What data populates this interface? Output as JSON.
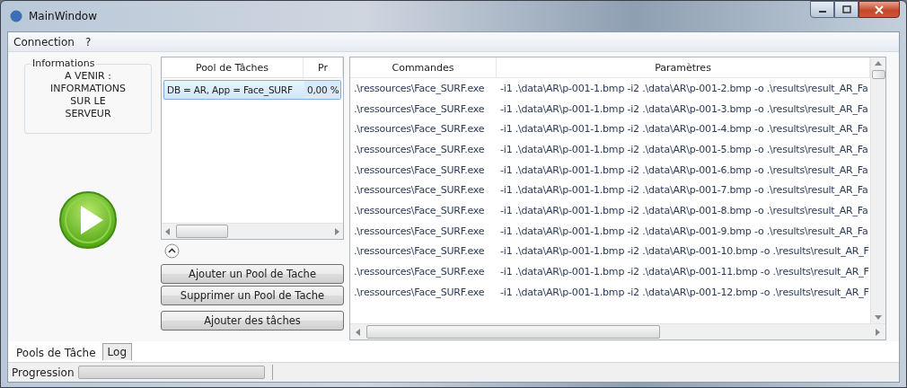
{
  "window": {
    "title": "MainWindow"
  },
  "menu": [
    {
      "label": "Connection"
    },
    {
      "label": "?"
    }
  ],
  "info_group": {
    "title": "Informations",
    "text": "A VENIR :\nINFORMATIONS\nSUR LE\nSERVEUR"
  },
  "pool_list": {
    "columns": [
      "Pool de Tâches",
      "Pr"
    ],
    "rows": [
      {
        "cells": [
          "DB = AR, App = Face_SURF",
          "0,00 %"
        ],
        "selected": true
      }
    ]
  },
  "pool_buttons": [
    "Ajouter un Pool de Tache",
    "Supprimer un Pool de Tache",
    "Ajouter des tâches"
  ],
  "commands_table": {
    "columns": [
      "Commandes",
      "Paramètres"
    ],
    "rows": [
      [
        ".\\ressources\\Face_SURF.exe",
        "-i1 .\\data\\AR\\p-001-1.bmp -i2 .\\data\\AR\\p-001-2.bmp -o .\\results\\result_AR_Fa"
      ],
      [
        ".\\ressources\\Face_SURF.exe",
        "-i1 .\\data\\AR\\p-001-1.bmp -i2 .\\data\\AR\\p-001-3.bmp -o .\\results\\result_AR_Fa"
      ],
      [
        ".\\ressources\\Face_SURF.exe",
        "-i1 .\\data\\AR\\p-001-1.bmp -i2 .\\data\\AR\\p-001-4.bmp -o .\\results\\result_AR_Fa"
      ],
      [
        ".\\ressources\\Face_SURF.exe",
        "-i1 .\\data\\AR\\p-001-1.bmp -i2 .\\data\\AR\\p-001-5.bmp -o .\\results\\result_AR_Fa"
      ],
      [
        ".\\ressources\\Face_SURF.exe",
        "-i1 .\\data\\AR\\p-001-1.bmp -i2 .\\data\\AR\\p-001-6.bmp -o .\\results\\result_AR_Fa"
      ],
      [
        ".\\ressources\\Face_SURF.exe",
        "-i1 .\\data\\AR\\p-001-1.bmp -i2 .\\data\\AR\\p-001-7.bmp -o .\\results\\result_AR_Fa"
      ],
      [
        ".\\ressources\\Face_SURF.exe",
        "-i1 .\\data\\AR\\p-001-1.bmp -i2 .\\data\\AR\\p-001-8.bmp -o .\\results\\result_AR_Fa"
      ],
      [
        ".\\ressources\\Face_SURF.exe",
        "-i1 .\\data\\AR\\p-001-1.bmp -i2 .\\data\\AR\\p-001-9.bmp -o .\\results\\result_AR_Fa"
      ],
      [
        ".\\ressources\\Face_SURF.exe",
        "-i1 .\\data\\AR\\p-001-1.bmp -i2 .\\data\\AR\\p-001-10.bmp -o .\\results\\result_AR_F"
      ],
      [
        ".\\ressources\\Face_SURF.exe",
        "-i1 .\\data\\AR\\p-001-1.bmp -i2 .\\data\\AR\\p-001-11.bmp -o .\\results\\result_AR_F"
      ],
      [
        ".\\ressources\\Face_SURF.exe",
        "-i1 .\\data\\AR\\p-001-1.bmp -i2 .\\data\\AR\\p-001-12.bmp -o .\\results\\result_AR_F"
      ]
    ]
  },
  "tabs": [
    {
      "label": "Pools de Tâche",
      "selected": true
    },
    {
      "label": "Log",
      "selected": false
    }
  ],
  "status_bar": {
    "label": "Progression",
    "progress": {
      "level": 0
    }
  }
}
